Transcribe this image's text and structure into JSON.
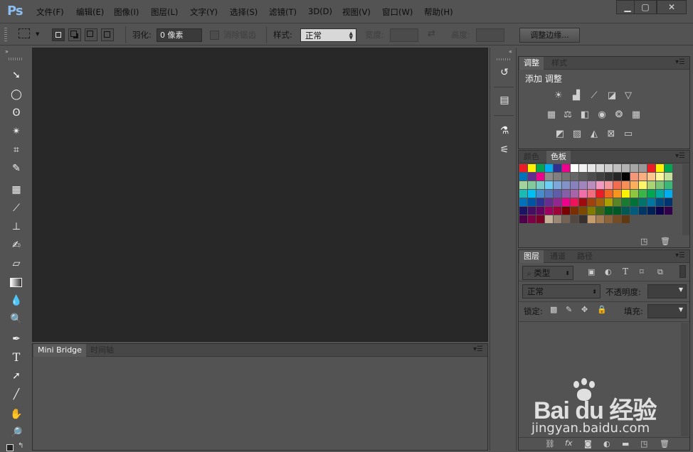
{
  "app": {
    "logo": "Ps"
  },
  "menu": [
    "文件(F)",
    "编辑(E)",
    "图像(I)",
    "图层(L)",
    "文字(Y)",
    "选择(S)",
    "滤镜(T)",
    "3D(D)",
    "视图(V)",
    "窗口(W)",
    "帮助(H)"
  ],
  "window_controls": {
    "minimize": "▁",
    "maximize": "▢",
    "close": "✕"
  },
  "options": {
    "feather_label": "羽化:",
    "feather_value": "0 像素",
    "antialias_label": "消除锯齿",
    "style_label": "样式:",
    "style_value": "正常",
    "width_label": "宽度:",
    "height_label": "高度:",
    "refine_button": "调整边缘..."
  },
  "tools": [
    "move-icon",
    "elliptical-marquee-icon",
    "lasso-icon",
    "magic-wand-icon",
    "crop-icon",
    "eyedropper-icon",
    "spot-healing-icon",
    "brush-icon",
    "clone-stamp-icon",
    "history-brush-icon",
    "eraser-icon",
    "gradient-icon",
    "blur-icon",
    "dodge-icon",
    "pen-icon",
    "type-icon",
    "path-selection-icon",
    "line-icon",
    "hand-icon",
    "zoom-icon"
  ],
  "bottom_panel": {
    "tabs": [
      "Mini Bridge",
      "时间轴"
    ]
  },
  "adjustments_panel": {
    "tabs": [
      "调整",
      "样式"
    ],
    "title": "添加 调整"
  },
  "color_panel": {
    "tabs": [
      "颜色",
      "色板"
    ]
  },
  "swatches": [
    "#ed1c24",
    "#fff200",
    "#00a651",
    "#00aeef",
    "#2e3192",
    "#ec008c",
    "#ffffff",
    "#f2f2f2",
    "#e6e6e6",
    "#d9d9d9",
    "#cccccc",
    "#bfbfbf",
    "#b3b3b3",
    "#a6a6a6",
    "#999999",
    "#ed1c24",
    "#fff200",
    "#00a651",
    "#0072bc",
    "#662d91",
    "#ec008c",
    "#8c8c8c",
    "#808080",
    "#737373",
    "#666666",
    "#595959",
    "#4d4d4d",
    "#404040",
    "#333333",
    "#262626",
    "#000000",
    "#f7977a",
    "#fbad82",
    "#fdc68c",
    "#fff799",
    "#c4df9b",
    "#a3d39c",
    "#82ca9c",
    "#7accc8",
    "#6dcff6",
    "#7da7d9",
    "#8393ca",
    "#8781bd",
    "#a186be",
    "#bd8cbf",
    "#f49ac1",
    "#f5989d",
    "#f26c4f",
    "#f68e56",
    "#fbaf5d",
    "#fff568",
    "#acd373",
    "#7cc576",
    "#3bb878",
    "#1abbb4",
    "#00bff3",
    "#448ccb",
    "#5574b9",
    "#605ca8",
    "#855fa8",
    "#a864a8",
    "#f06eaa",
    "#f26d7d",
    "#ed1c24",
    "#f26522",
    "#f7941d",
    "#fff200",
    "#8dc63f",
    "#39b54a",
    "#00a651",
    "#00a99d",
    "#00aeef",
    "#0072bc",
    "#0054a6",
    "#2e3192",
    "#662d91",
    "#92278f",
    "#ec008c",
    "#ed145b",
    "#9e0b0f",
    "#a0410d",
    "#a36209",
    "#aba000",
    "#598527",
    "#197b30",
    "#007236",
    "#00746b",
    "#0076a3",
    "#004a80",
    "#003471",
    "#1b1464",
    "#440e62",
    "#630460",
    "#9e005d",
    "#9e0039",
    "#790000",
    "#7b2e00",
    "#7d4900",
    "#827b00",
    "#406618",
    "#005e20",
    "#005826",
    "#005952",
    "#005b7f",
    "#003663",
    "#002157",
    "#0d004c",
    "#32004b",
    "#4b0049",
    "#7b0046",
    "#7a0026",
    "#c7b299",
    "#998675",
    "#736357",
    "#534741",
    "#37302d",
    "#c69c6d",
    "#a67c52",
    "#8c6239",
    "#754c24",
    "#603913"
  ],
  "layers_panel": {
    "tabs": [
      "图层",
      "通道",
      "路径"
    ],
    "filter_label": "类型",
    "blend_mode": "正常",
    "opacity_label": "不透明度:",
    "lock_label": "锁定:",
    "fill_label": "填充:"
  },
  "watermark": {
    "brand": "Bai du 经验",
    "url": "jingyan.baidu.com"
  }
}
